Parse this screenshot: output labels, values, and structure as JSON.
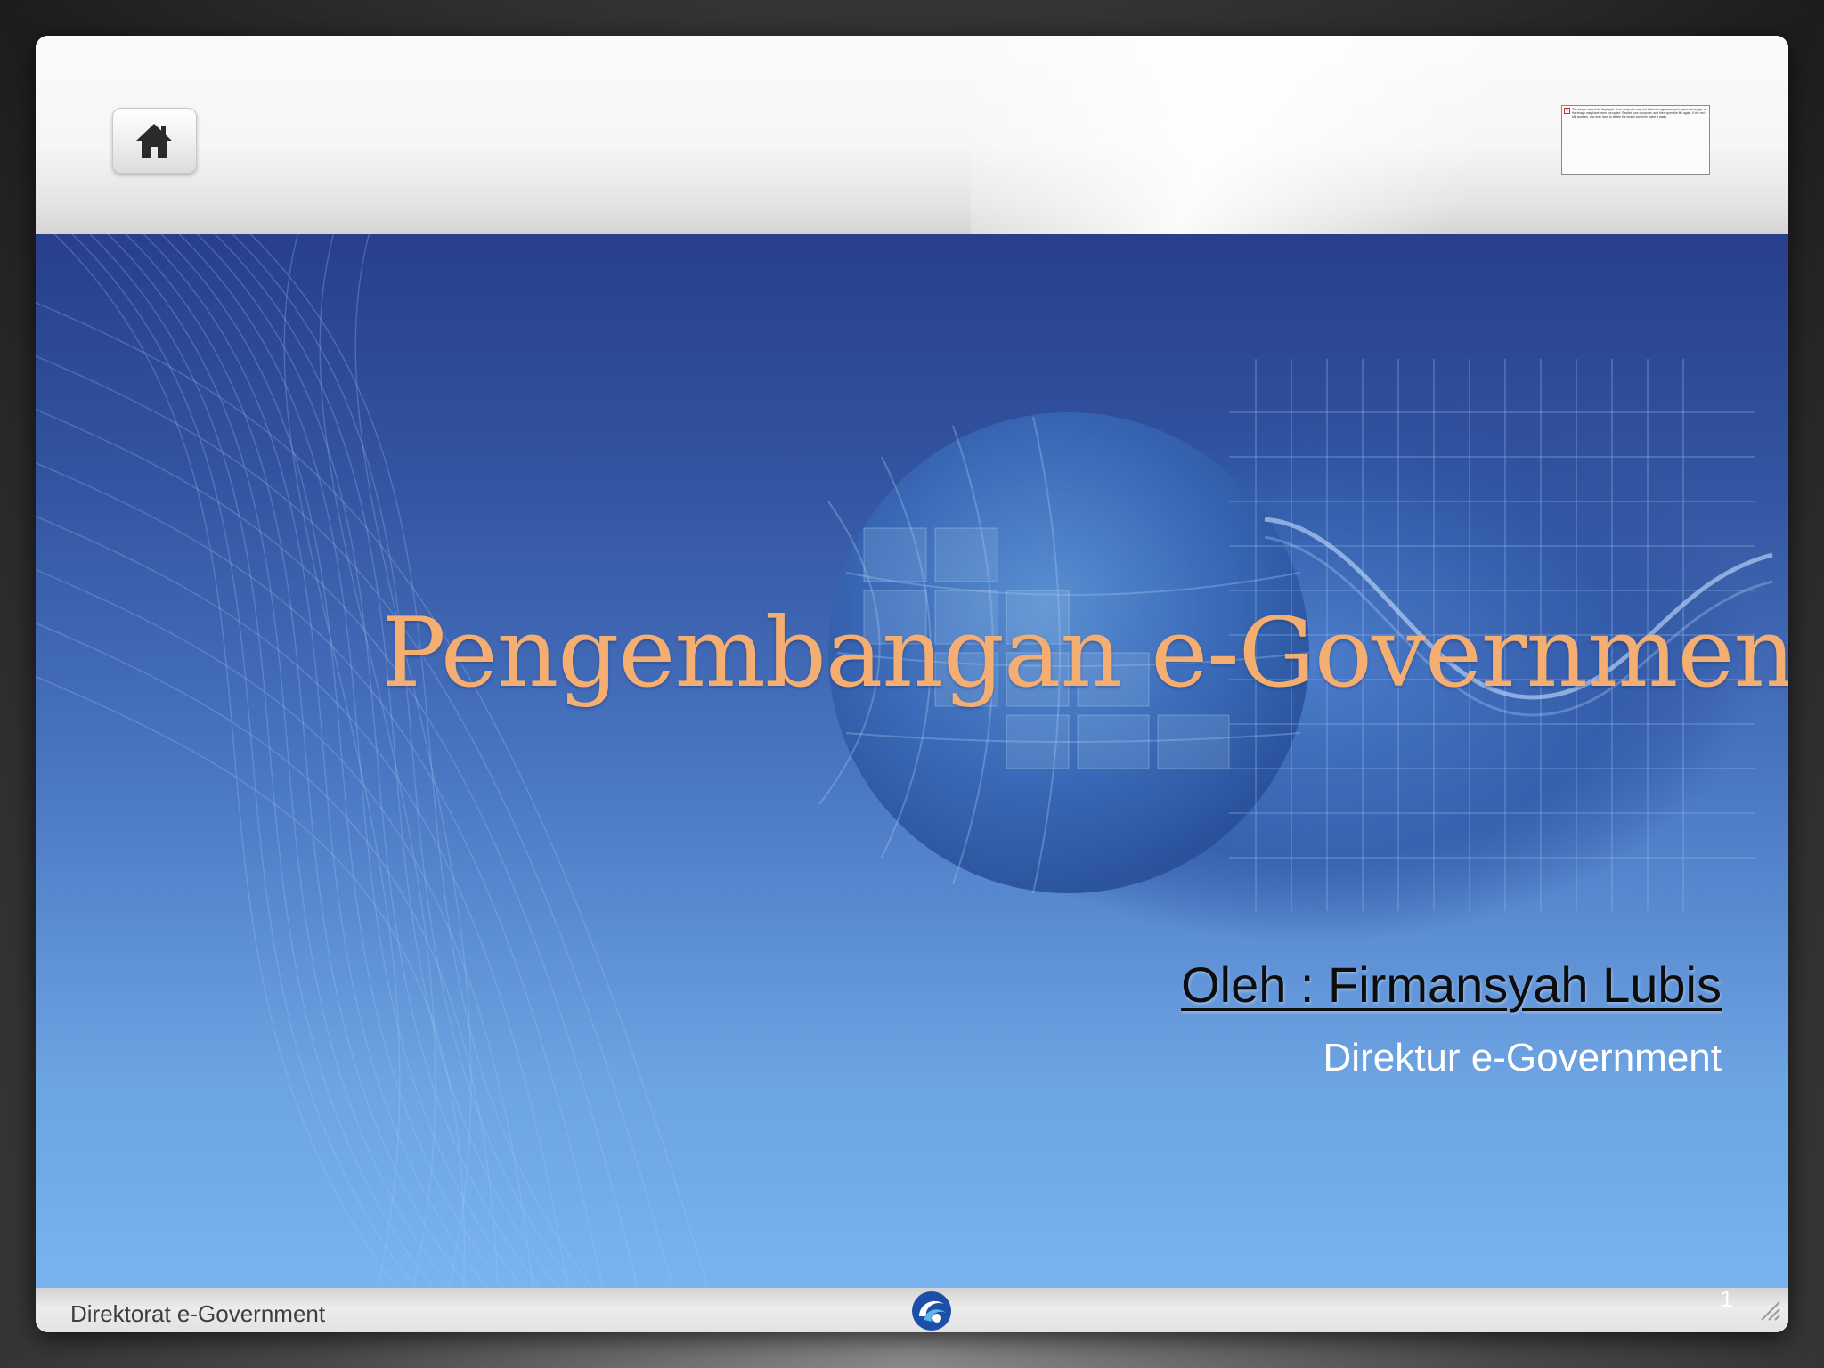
{
  "header": {
    "home_button": {
      "icon": "home-icon"
    },
    "image_placeholder": {
      "icon": "broken-image-icon",
      "message": "The image cannot be displayed. Your computer may not have enough memory to open the image, or the image may have been corrupted. Restart your computer, and then open the file again. If the red x still appears, you may have to delete the image and then insert it again."
    }
  },
  "slide": {
    "title": "Pengembangan e-Government",
    "author": "Oleh : Firmansyah Lubis",
    "role": "Direktur e-Government"
  },
  "footer": {
    "text": "Direktorat e-Government",
    "logo_icon": "kominfo-logo-icon",
    "page_number": "1"
  },
  "colors": {
    "title": "#f4ae72",
    "background_top": "#283f8c",
    "background_bottom": "#79b3f0",
    "author": "#0d0d0d",
    "role": "#ffffff"
  }
}
